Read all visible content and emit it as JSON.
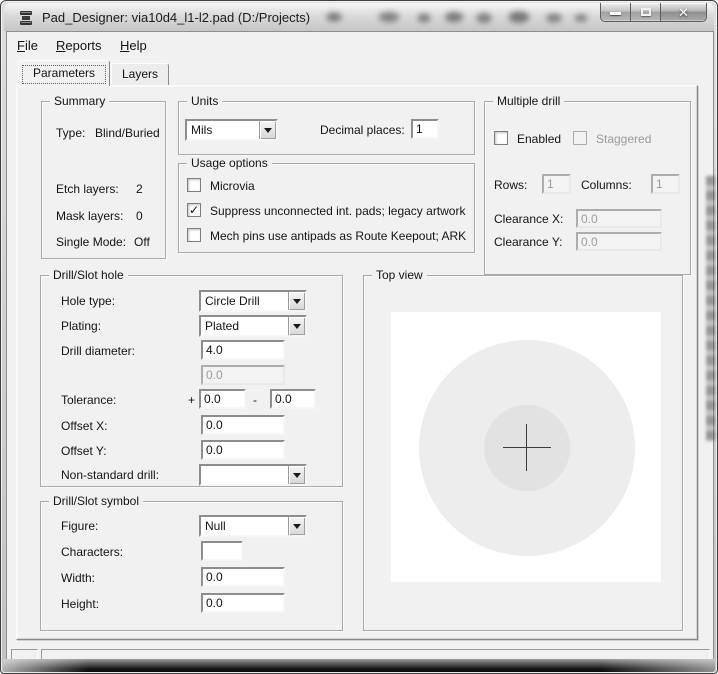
{
  "window": {
    "title": "Pad_Designer: via10d4_l1-l2.pad (D:/Projects)"
  },
  "icons": {
    "close_glyph": "✕",
    "check_glyph": "✓"
  },
  "menu": {
    "items": [
      {
        "accel": "F",
        "rest": "ile"
      },
      {
        "accel": "R",
        "rest": "eports"
      },
      {
        "accel": "H",
        "rest": "elp"
      }
    ]
  },
  "tabs": {
    "parameters": "Parameters",
    "layers": "Layers"
  },
  "summary": {
    "title": "Summary",
    "type": {
      "label": "Type:",
      "value": "Blind/Buried"
    },
    "etch": {
      "label": "Etch layers:",
      "value": "2"
    },
    "mask": {
      "label": "Mask layers:",
      "value": "0"
    },
    "single": {
      "label": "Single Mode:",
      "value": "Off"
    }
  },
  "units": {
    "title": "Units",
    "selected": "Mils",
    "decimal_label": "Decimal places:",
    "decimal_value": "1"
  },
  "usage_options": {
    "title": "Usage options",
    "options": [
      {
        "label": "Microvia",
        "checked": false,
        "mark": ""
      },
      {
        "label": "Suppress unconnected int. pads; legacy artwork",
        "checked": true,
        "mark": "✓"
      },
      {
        "label": "Mech pins use antipads as Route Keepout; ARK",
        "checked": false,
        "mark": ""
      }
    ]
  },
  "multiple_drill": {
    "title": "Multiple drill",
    "enabled": {
      "label": "Enabled",
      "checked": false,
      "mark": ""
    },
    "staggered": {
      "label": "Staggered",
      "checked": false,
      "disabled": true,
      "mark": ""
    },
    "rows": {
      "label": "Rows:",
      "value": "1",
      "disabled": true
    },
    "columns": {
      "label": "Columns:",
      "value": "1",
      "disabled": true
    },
    "clearance_x": {
      "label": "Clearance X:",
      "value": "0.0",
      "disabled": true
    },
    "clearance_y": {
      "label": "Clearance Y:",
      "value": "0.0",
      "disabled": true
    }
  },
  "drill_hole": {
    "title": "Drill/Slot hole",
    "hole_type": {
      "label": "Hole type:",
      "value": "Circle Drill"
    },
    "plating": {
      "label": "Plating:",
      "value": "Plated"
    },
    "diameter": {
      "label": "Drill diameter:",
      "value": "4.0"
    },
    "diameter_secondary": {
      "value": "0.0",
      "disabled": true
    },
    "tolerance": {
      "label": "Tolerance:",
      "plus_sign": "+",
      "plus_value": "0.0",
      "minus_sign": "-",
      "minus_value": "0.0"
    },
    "offset_x": {
      "label": "Offset X:",
      "value": "0.0"
    },
    "offset_y": {
      "label": "Offset Y:",
      "value": "0.0"
    },
    "non_standard": {
      "label": "Non-standard drill:",
      "value": ""
    }
  },
  "drill_symbol": {
    "title": "Drill/Slot symbol",
    "figure": {
      "label": "Figure:",
      "value": "Null"
    },
    "characters": {
      "label": "Characters:",
      "value": ""
    },
    "width": {
      "label": "Width:",
      "value": "0.0"
    },
    "height": {
      "label": "Height:",
      "value": "0.0"
    }
  },
  "top_view": {
    "title": "Top view"
  },
  "colors": {
    "dialog_bg": "#f1f1f1",
    "pad_circle": "#ededed",
    "drill_circle": "#e2e2e2",
    "crosshair": "#3a3a3a"
  }
}
